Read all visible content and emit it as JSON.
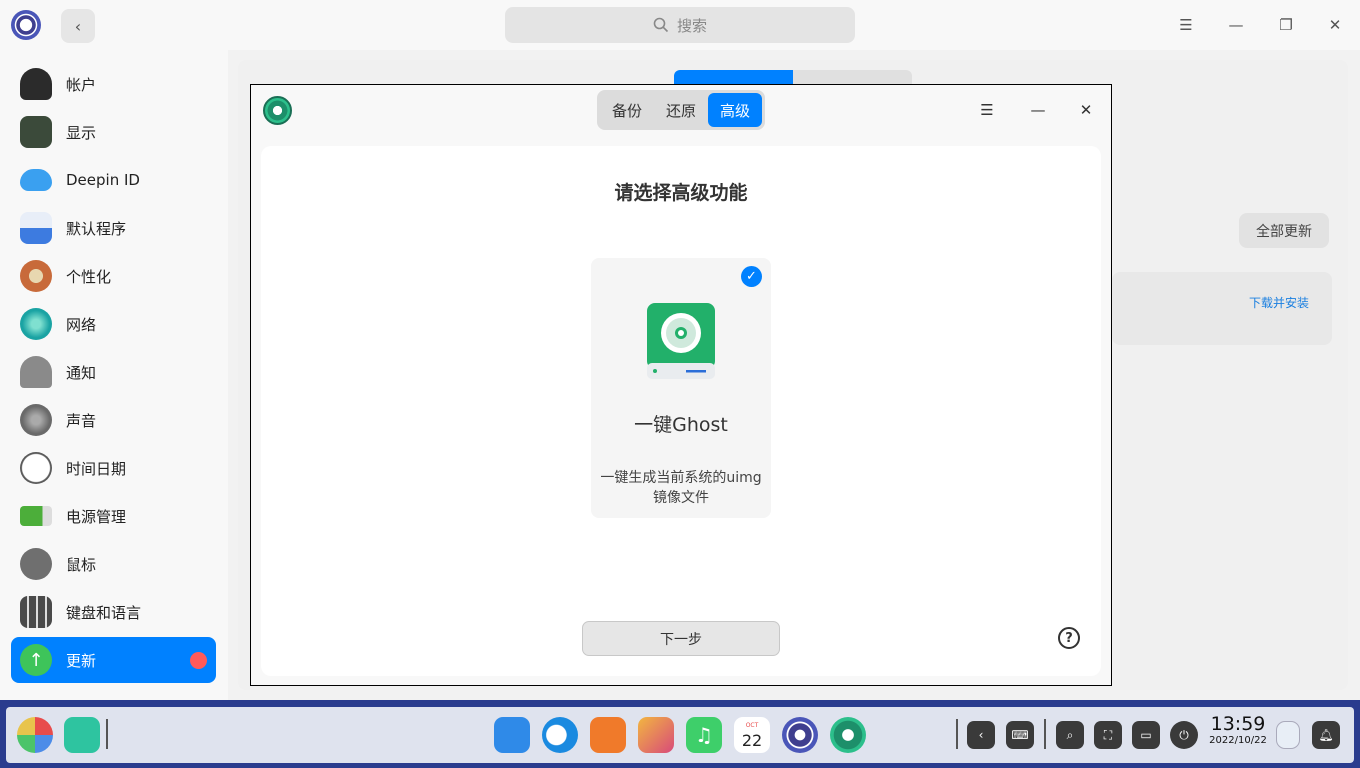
{
  "search": {
    "placeholder": "搜索",
    "icon": "search-icon"
  },
  "sidebar": {
    "items": [
      {
        "label": "帐户",
        "icon": "account-icon",
        "color": "#2b2b2b"
      },
      {
        "label": "显示",
        "icon": "display-icon",
        "color": "#3b4a3a"
      },
      {
        "label": "Deepin ID",
        "icon": "cloud-icon",
        "color": "#3aa0f0"
      },
      {
        "label": "默认程序",
        "icon": "default-apps-icon",
        "color": "#3d7be0"
      },
      {
        "label": "个性化",
        "icon": "personalization-icon",
        "color": "#c86a3a"
      },
      {
        "label": "网络",
        "icon": "network-icon",
        "color": "#1aa3a3"
      },
      {
        "label": "通知",
        "icon": "bell-icon",
        "color": "#8a8a8a"
      },
      {
        "label": "声音",
        "icon": "speaker-icon",
        "color": "#6a6a6a"
      },
      {
        "label": "时间日期",
        "icon": "clock-icon",
        "color": "#5a5a5a"
      },
      {
        "label": "电源管理",
        "icon": "battery-icon",
        "color": "#4cae3a"
      },
      {
        "label": "鼠标",
        "icon": "mouse-icon",
        "color": "#6f6f6f"
      },
      {
        "label": "键盘和语言",
        "icon": "keyboard-icon",
        "color": "#4a4a4a"
      },
      {
        "label": "更新",
        "icon": "update-icon",
        "color": "#3ec45a",
        "active": true
      }
    ]
  },
  "update_page": {
    "update_all_label": "全部更新",
    "download_install_label": "下载并安装"
  },
  "dialog": {
    "tabs": [
      {
        "label": "备份"
      },
      {
        "label": "还原"
      },
      {
        "label": "高级",
        "active": true
      }
    ],
    "heading": "请选择高级功能",
    "feature": {
      "title": "一键Ghost",
      "description": "一键生成当前系统的uimg镜像文件",
      "selected": true
    },
    "next_label": "下一步",
    "help_label": "?"
  },
  "taskbar": {
    "apps": [
      "launcher-icon",
      "terminal-icon",
      "file-manager-icon",
      "browser-icon",
      "app-store-icon",
      "image-viewer-icon",
      "music-icon",
      "calendar-icon",
      "control-center-icon",
      "backup-restore-icon"
    ],
    "calendar_month": "OCT",
    "calendar_day": "22",
    "time": "13:59",
    "date": "2022/10/22"
  },
  "colors": {
    "accent": "#0081ff",
    "taskbar": "#2a3c8e",
    "badge": "#ff5a5a"
  }
}
